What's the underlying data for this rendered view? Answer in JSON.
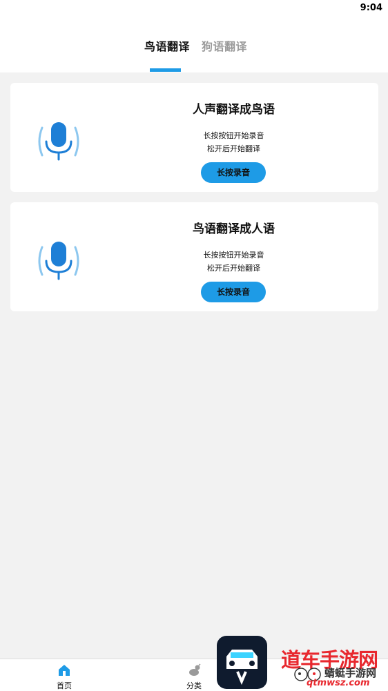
{
  "status": {
    "time": "9:04"
  },
  "tabs": [
    {
      "label": "鸟语翻译",
      "active": true
    },
    {
      "label": "狗语翻译",
      "active": false
    }
  ],
  "cards": [
    {
      "title": "人声翻译成鸟语",
      "line1": "长按按钮开始录音",
      "line2": "松开后开始翻译",
      "button": "长按录音",
      "icon": "microphone-icon"
    },
    {
      "title": "鸟语翻译成人语",
      "line1": "长按按钮开始录音",
      "line2": "松开后开始翻译",
      "button": "长按录音",
      "icon": "microphone-icon"
    }
  ],
  "bottom_nav": [
    {
      "label": "首页",
      "icon": "home-icon",
      "active": true
    },
    {
      "label": "分类",
      "icon": "category-icon",
      "active": false
    }
  ],
  "watermark": {
    "title": "道车手游网",
    "subtitle": "蜻蜓手游网",
    "url": "qtmwsz.com"
  },
  "colors": {
    "accent": "#1e9be6",
    "background": "#f2f2f2",
    "watermark_red": "#e8282e"
  }
}
